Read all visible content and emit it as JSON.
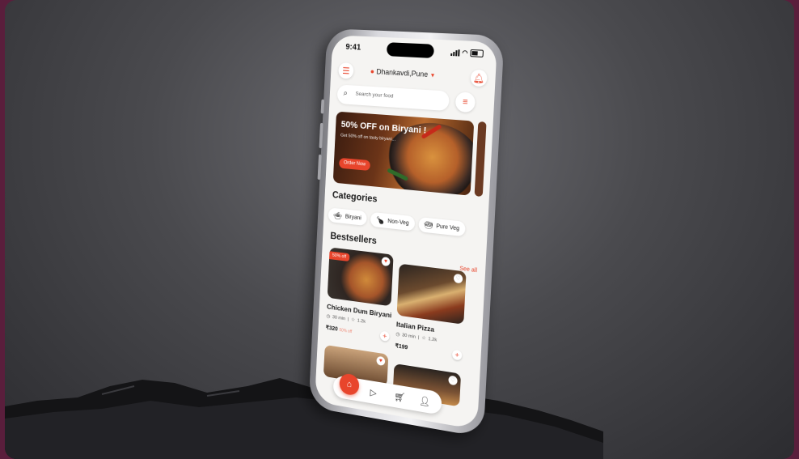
{
  "status_bar": {
    "time": "9:41"
  },
  "header": {
    "location": "Dhankavdi,Pune"
  },
  "search": {
    "placeholder": "Search your food"
  },
  "banner": {
    "title": "50% OFF on Biryani !",
    "subtitle": "Get 50% off on tasty biryani...",
    "cta": "Order Now"
  },
  "categories": {
    "title": "Categories",
    "items": [
      {
        "label": "Biryani",
        "icon": "biryani-icon"
      },
      {
        "label": "Non-Veg",
        "icon": "drumstick-icon"
      },
      {
        "label": "Pure Veg",
        "icon": "veg-icon"
      }
    ]
  },
  "bestsellers": {
    "title": "Bestsellers",
    "see_all": "See all",
    "items": [
      {
        "name": "Chicken Dum Biryani",
        "time": "30 min",
        "rating": "1.2k",
        "price": "₹320",
        "discount": "50% off",
        "badge": "50% off"
      },
      {
        "name": "Italian Pizza",
        "time": "30 min",
        "rating": "1.2k",
        "price": "₹199"
      }
    ]
  },
  "colors": {
    "accent": "#e8452c",
    "screen_bg": "#f5f4f2"
  }
}
